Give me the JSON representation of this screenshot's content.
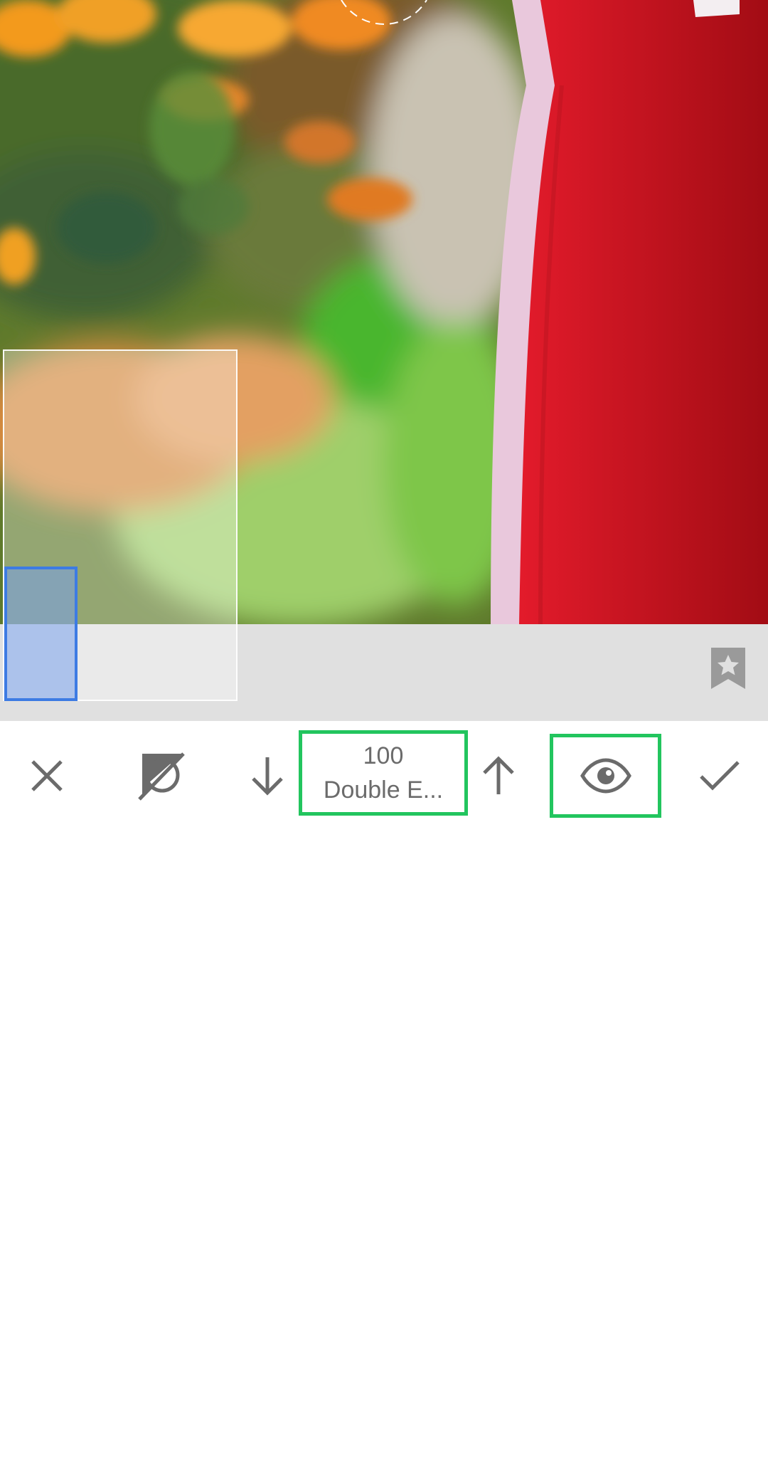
{
  "editor": {
    "value": "100",
    "label": "Double E..."
  },
  "toolbar": {
    "icons": [
      "close-icon",
      "mask-icon",
      "arrow-down-icon",
      "arrow-up-icon",
      "eye-icon",
      "check-icon"
    ]
  },
  "colors": {
    "highlight": "#22c55e",
    "navigator_viewport": "#3d7be3",
    "icon": "#6b6b6b",
    "strip_background": "#e0e0e0"
  }
}
